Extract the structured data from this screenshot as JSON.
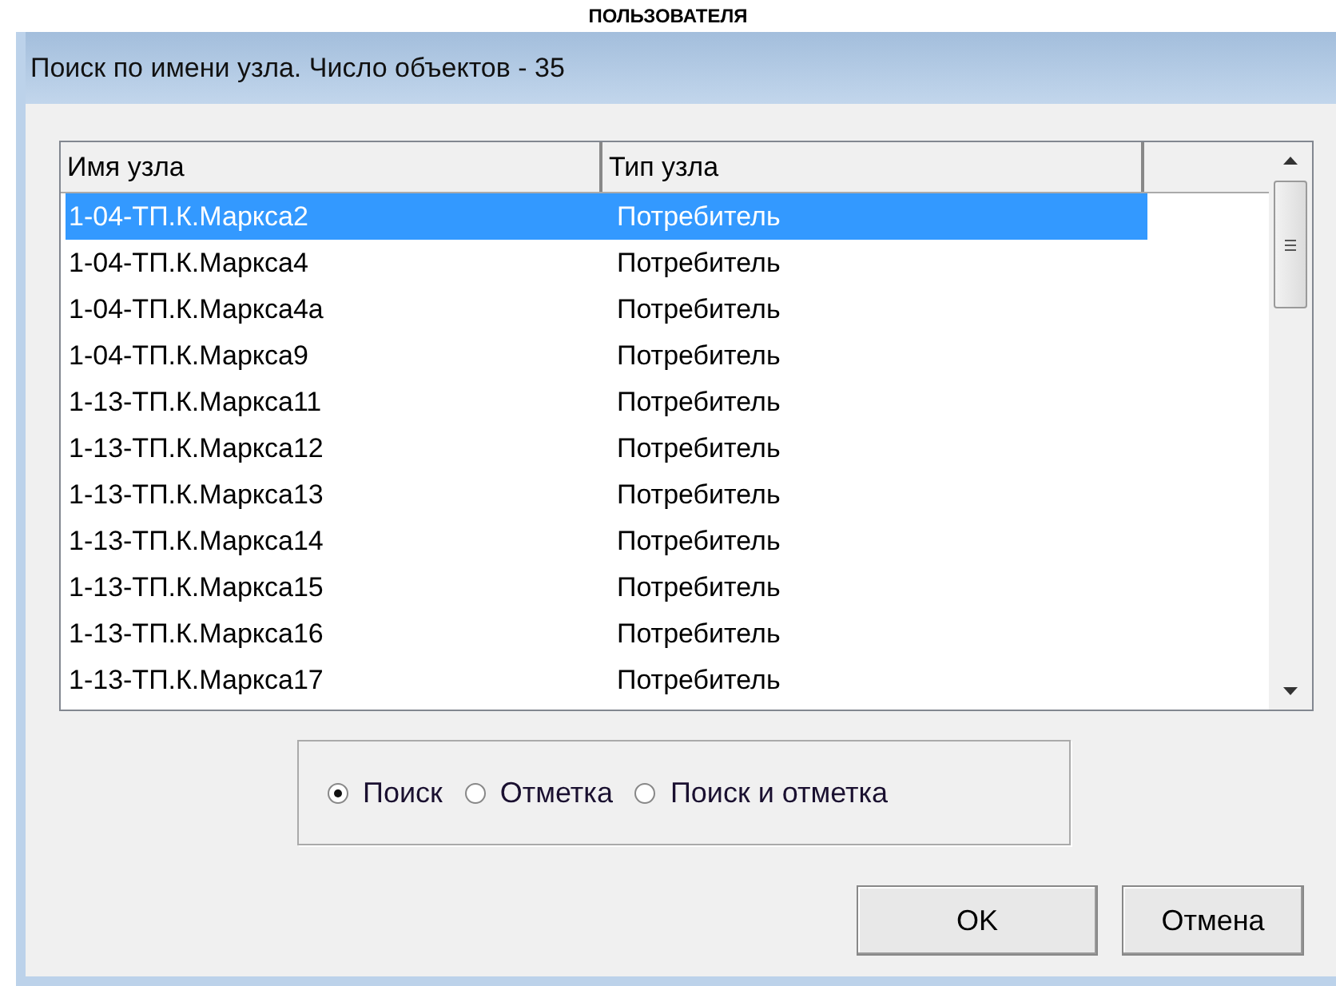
{
  "page_header": "ПОЛЬЗОВАТЕЛЯ",
  "window": {
    "title": "Поиск по имени узла. Число объектов - 35"
  },
  "table": {
    "columns": [
      "Имя узла",
      "Тип узла"
    ],
    "rows": [
      {
        "name": "1-04-ТП.К.Маркса2",
        "type": "Потребитель",
        "selected": true
      },
      {
        "name": "1-04-ТП.К.Маркса4",
        "type": "Потребитель",
        "selected": false
      },
      {
        "name": "1-04-ТП.К.Маркса4а",
        "type": "Потребитель",
        "selected": false
      },
      {
        "name": "1-04-ТП.К.Маркса9",
        "type": "Потребитель",
        "selected": false
      },
      {
        "name": "1-13-ТП.К.Маркса11",
        "type": "Потребитель",
        "selected": false
      },
      {
        "name": "1-13-ТП.К.Маркса12",
        "type": "Потребитель",
        "selected": false
      },
      {
        "name": "1-13-ТП.К.Маркса13",
        "type": "Потребитель",
        "selected": false
      },
      {
        "name": "1-13-ТП.К.Маркса14",
        "type": "Потребитель",
        "selected": false
      },
      {
        "name": "1-13-ТП.К.Маркса15",
        "type": "Потребитель",
        "selected": false
      },
      {
        "name": "1-13-ТП.К.Маркса16",
        "type": "Потребитель",
        "selected": false
      },
      {
        "name": "1-13-ТП.К.Маркса17",
        "type": "Потребитель",
        "selected": false
      }
    ]
  },
  "mode_options": [
    {
      "label": "Поиск",
      "selected": true
    },
    {
      "label": "Отметка",
      "selected": false
    },
    {
      "label": "Поиск и отметка",
      "selected": false
    }
  ],
  "buttons": [
    "OK",
    "Отмена"
  ]
}
